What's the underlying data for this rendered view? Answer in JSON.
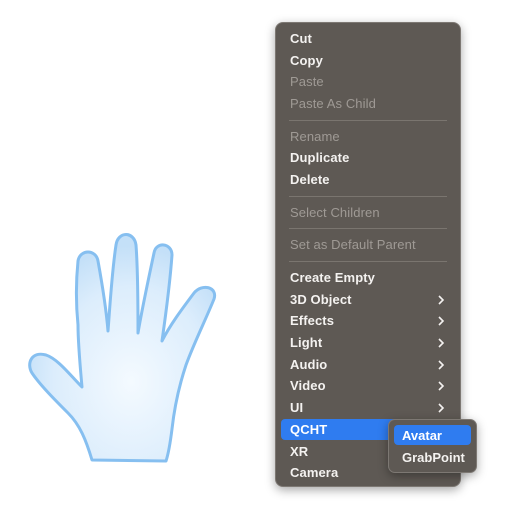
{
  "menu": {
    "items": [
      {
        "label": "Cut"
      },
      {
        "label": "Copy"
      },
      {
        "label": "Paste"
      },
      {
        "label": "Paste As Child"
      },
      {
        "label": "Rename"
      },
      {
        "label": "Duplicate"
      },
      {
        "label": "Delete"
      },
      {
        "label": "Select Children"
      },
      {
        "label": "Set as Default Parent"
      },
      {
        "label": "Create Empty"
      },
      {
        "label": "3D Object"
      },
      {
        "label": "Effects"
      },
      {
        "label": "Light"
      },
      {
        "label": "Audio"
      },
      {
        "label": "Video"
      },
      {
        "label": "UI"
      },
      {
        "label": "QCHT"
      },
      {
        "label": "XR"
      },
      {
        "label": "Camera"
      }
    ]
  },
  "submenu": {
    "items": [
      {
        "label": "Avatar"
      },
      {
        "label": "GrabPoint"
      }
    ]
  },
  "colors": {
    "menu_bg": "#5e5954",
    "highlight": "#2f7cf0",
    "enabled_text": "#f4f2f0",
    "disabled_text": "#9f9a95",
    "hand_fill": "#cfe6fb",
    "hand_outline": "#86bff0"
  },
  "icons": {
    "submenu_arrow": "chevron-right-icon",
    "hand": "hand-illustration"
  }
}
